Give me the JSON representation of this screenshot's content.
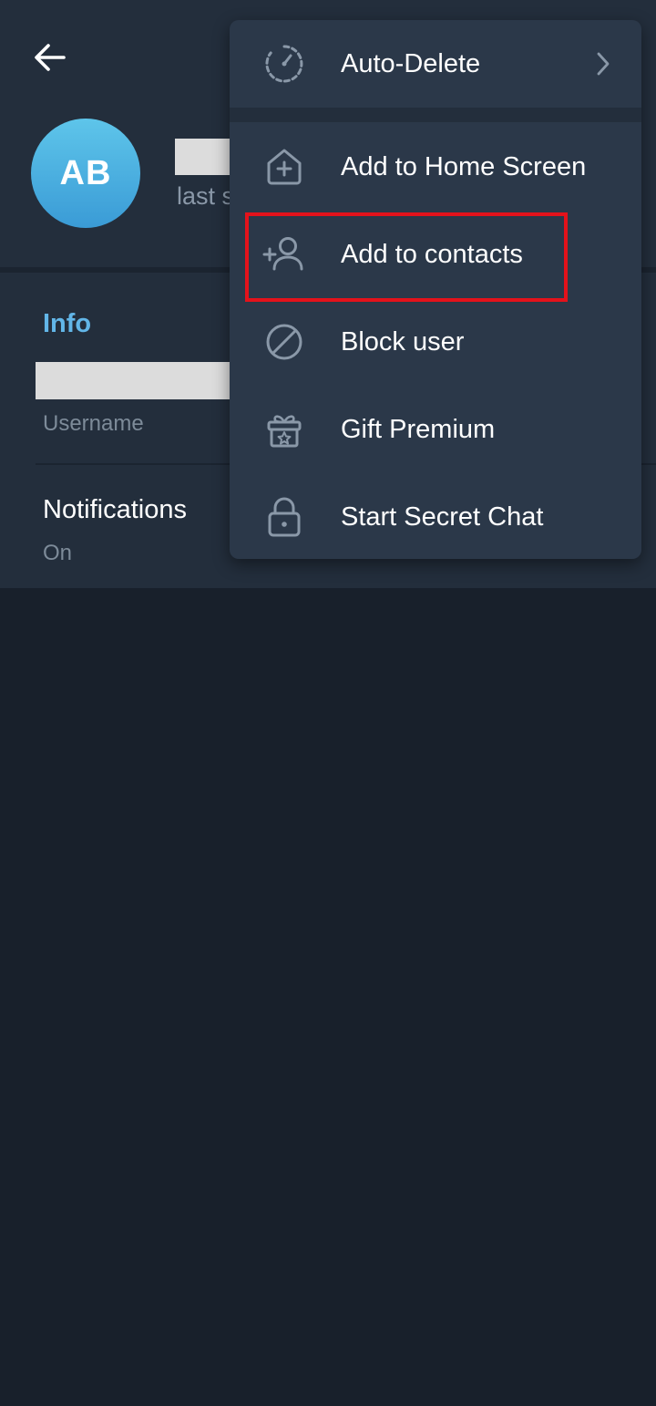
{
  "header": {
    "avatar_initials": "AB",
    "last_seen_text": "last s"
  },
  "info": {
    "section_title": "Info",
    "username_label": "Username",
    "notifications_title": "Notifications",
    "notifications_value": "On"
  },
  "menu": {
    "items": [
      {
        "label": "Auto-Delete",
        "icon": "timer-icon"
      },
      {
        "label": "Add to Home Screen",
        "icon": "home-add-icon"
      },
      {
        "label": "Add to contacts",
        "icon": "add-user-icon"
      },
      {
        "label": "Block user",
        "icon": "block-icon"
      },
      {
        "label": "Gift Premium",
        "icon": "gift-icon"
      },
      {
        "label": "Start Secret Chat",
        "icon": "lock-icon"
      }
    ]
  },
  "colors": {
    "background": "#18202b",
    "panel": "#232e3c",
    "menu": "#2b3849",
    "accent": "#62b6e8",
    "highlight": "#e4121b"
  }
}
